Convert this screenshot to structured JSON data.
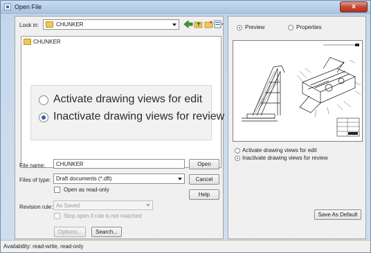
{
  "window": {
    "title": "Open File",
    "close_glyph": "x"
  },
  "look_in": {
    "label": "Look in:",
    "value": "CHUNKER",
    "icons": [
      "back-arrow-icon",
      "up-folder-icon",
      "new-folder-icon",
      "views-menu-icon"
    ]
  },
  "file_list": [
    {
      "name": "CHUNKER",
      "icon": "folder-icon"
    }
  ],
  "overlay": {
    "options": [
      {
        "label": "Activate drawing views for edit",
        "checked": false
      },
      {
        "label": "Inactivate drawing views for review",
        "checked": true
      }
    ]
  },
  "file_name": {
    "label": "File name:",
    "value": "CHUNKER"
  },
  "file_type": {
    "label": "Files of type:",
    "value": "Draft documents (*.dft)"
  },
  "open_read_only": {
    "label": "Open as read-only",
    "checked": false
  },
  "revision_rule": {
    "label": "Revision rule:",
    "value": "As Saved",
    "enabled": false
  },
  "stop_open": {
    "label": "Stop open if rule is not matched",
    "checked": false,
    "enabled": false
  },
  "buttons": {
    "open": "Open",
    "cancel": "Cancel",
    "help": "Help",
    "options": "Options...",
    "search": "Search...",
    "save_default": "Save As Default"
  },
  "right_panel": {
    "tabs": [
      {
        "label": "Preview",
        "selected": true
      },
      {
        "label": "Properties",
        "selected": false
      }
    ],
    "options": [
      {
        "label": "Activate drawing views for edit",
        "checked": false
      },
      {
        "label": "Inactivate drawing views for review",
        "checked": true
      }
    ]
  },
  "status": "Availability: read-write, read-only",
  "colors": {
    "accent": "#2f62a8",
    "close": "#c4483a",
    "folder": "#f1c75a"
  }
}
